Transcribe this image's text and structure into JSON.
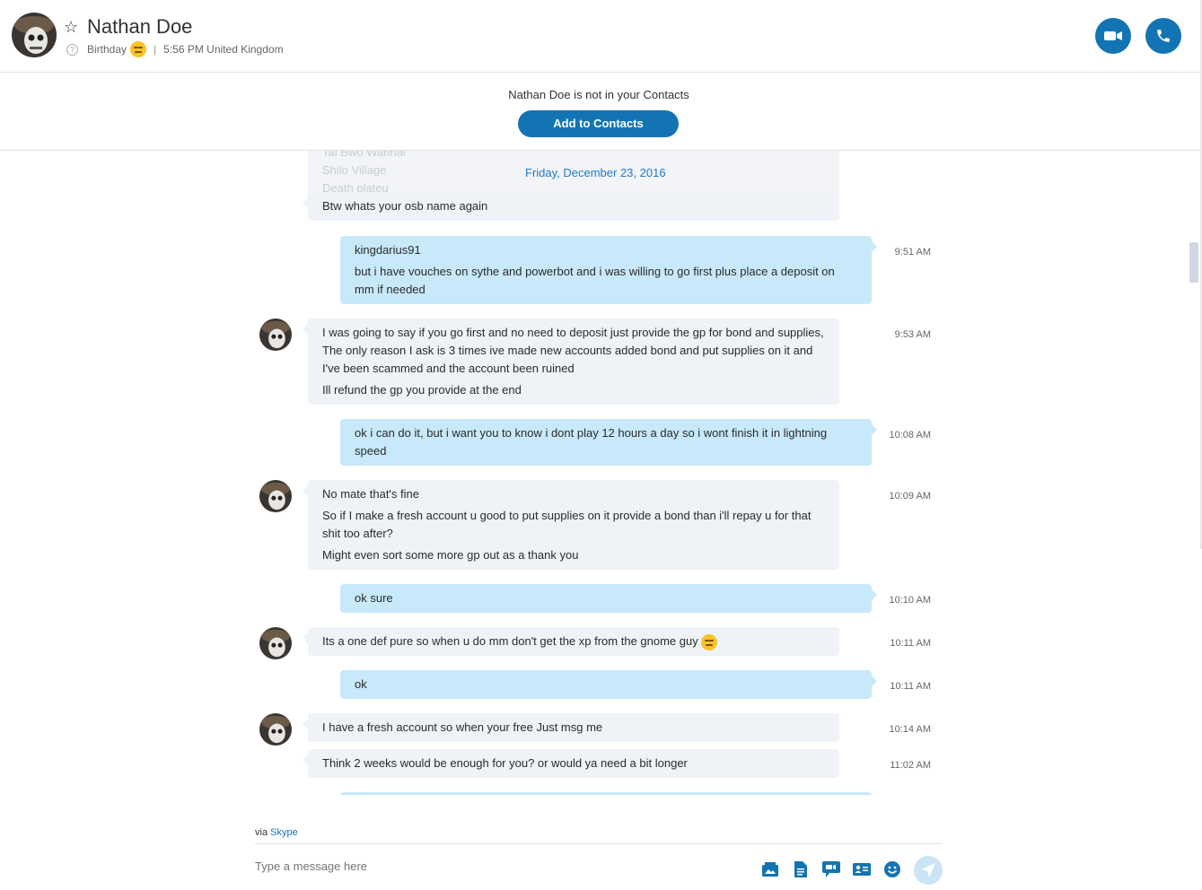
{
  "header": {
    "contact_name": "Nathan Doe",
    "status_label": "Birthday",
    "separator": "|",
    "local_time": "5:56 PM United Kingdom"
  },
  "notice": {
    "text": "Nathan Doe is not in your Contacts",
    "button": "Add to Contacts"
  },
  "conversation": {
    "date": "Friday, December 23, 2016",
    "faded_lines": [
      "Tai Bwo Wannai",
      "Shilo Village",
      "Death plateu"
    ],
    "messages": [
      {
        "dir": "in",
        "lines": [
          "Btw whats your osb name again"
        ],
        "time": ""
      },
      {
        "dir": "out",
        "lines": [
          "kingdarius91",
          "but i have vouches on sythe and powerbot and i was willing to go first plus place a deposit on mm if needed"
        ],
        "time": "9:51 AM"
      },
      {
        "dir": "in",
        "lines": [
          "I was going to say if you go first and no need to deposit just provide the gp for bond and supplies, The only reason I ask is 3 times ive made new accounts added bond and put supplies on it and I've been scammed and the account been ruined",
          "Ill refund the gp you provide at the end"
        ],
        "time": "9:53 AM"
      },
      {
        "dir": "out",
        "lines": [
          "ok i can do it, but i want you to know i dont play 12 hours a day so i wont finish it in lightning speed"
        ],
        "time": "10:08 AM"
      },
      {
        "dir": "in",
        "lines": [
          "No mate that's fine",
          "So if I make a fresh account u good to put supplies on it provide a bond than i'll repay u for that shit too after?",
          "Might even sort some more gp out as a thank you"
        ],
        "time": "10:09 AM"
      },
      {
        "dir": "out",
        "lines": [
          "ok sure"
        ],
        "time": "10:10 AM"
      },
      {
        "dir": "in",
        "lines": [
          "Its a one def pure so when u do mm don't get the xp from the gnome guy"
        ],
        "time": "10:11 AM"
      },
      {
        "dir": "out",
        "lines": [
          "ok"
        ],
        "time": "10:11 AM"
      },
      {
        "dir": "in",
        "lines": [
          "I have a fresh account so when your free Just msg me"
        ],
        "time": "10:14 AM"
      },
      {
        "dir": "in",
        "lines": [
          "Think 2 weeks would be enough for you? or would ya need a bit longer"
        ],
        "time": "11:02 AM"
      }
    ]
  },
  "composer": {
    "via_prefix": "via",
    "via_service": "Skype",
    "placeholder": "Type a message here"
  },
  "colors": {
    "accent": "#1374b4",
    "outgoing_bubble": "#c7e9fa",
    "incoming_bubble": "#eff2f6",
    "date_text": "#1e7bc3"
  },
  "icons": [
    "star-icon",
    "help-icon",
    "video-call-icon",
    "audio-call-icon",
    "media-gallery-icon",
    "file-icon",
    "video-message-icon",
    "contact-card-icon",
    "emoticon-icon",
    "send-icon"
  ]
}
